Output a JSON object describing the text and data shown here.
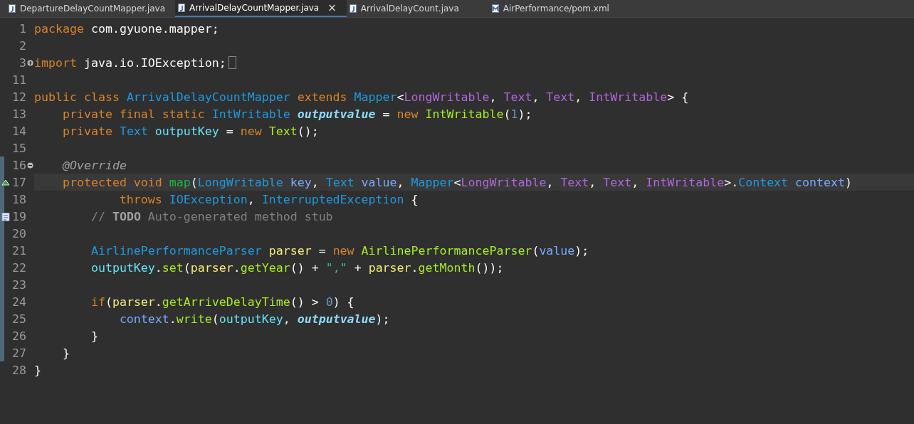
{
  "tabs": [
    {
      "label": "DepartureDelayCountMapper.java",
      "kind": "java",
      "selected": false
    },
    {
      "label": "ArrivalDelayCountMapper.java",
      "kind": "java",
      "selected": true,
      "close": "×"
    },
    {
      "label": "ArrivalDelayCount.java",
      "kind": "java",
      "selected": false
    },
    {
      "label": "AirPerformance/pom.xml",
      "kind": "xml",
      "selected": false
    }
  ],
  "editor": {
    "lines": [
      {
        "number": "1",
        "kind": "code",
        "changed": false,
        "current": false,
        "tokens": [
          {
            "kind": "keyword",
            "text": "package"
          },
          {
            "kind": "plain",
            "text": " com.gyuone.mapper;"
          }
        ]
      },
      {
        "number": "2",
        "kind": "code",
        "changed": false,
        "current": false
      },
      {
        "number": "3",
        "kind": "folded",
        "changed": false,
        "current": false,
        "tokens": [
          {
            "kind": "keyword",
            "text": "import"
          },
          {
            "kind": "plain",
            "text": " java.io.IOException;"
          }
        ]
      },
      {
        "number": "11",
        "kind": "code",
        "changed": false,
        "current": false
      },
      {
        "number": "12",
        "kind": "code",
        "changed": false,
        "current": false,
        "tokens": [
          {
            "kind": "keyword",
            "text": "public class "
          },
          {
            "kind": "type",
            "text": "ArrivalDelayCountMapper"
          },
          {
            "kind": "keyword",
            "text": " extends "
          },
          {
            "kind": "type",
            "text": "Mapper"
          },
          {
            "kind": "plain",
            "text": "<"
          },
          {
            "kind": "typearg",
            "text": "LongWritable"
          },
          {
            "kind": "plain",
            "text": ", "
          },
          {
            "kind": "typearg",
            "text": "Text"
          },
          {
            "kind": "plain",
            "text": ", "
          },
          {
            "kind": "typearg",
            "text": "Text"
          },
          {
            "kind": "plain",
            "text": ", "
          },
          {
            "kind": "typearg",
            "text": "IntWritable"
          },
          {
            "kind": "plain",
            "text": "> {"
          }
        ]
      },
      {
        "number": "13",
        "kind": "code",
        "changed": false,
        "current": false,
        "tokens": [
          {
            "kind": "keyword",
            "text": "    private final static "
          },
          {
            "kind": "type",
            "text": "IntWritable "
          },
          {
            "kind": "static",
            "text": "outputvalue"
          },
          {
            "kind": "plain",
            "text": " = "
          },
          {
            "kind": "keyword",
            "text": "new "
          },
          {
            "kind": "method",
            "text": "IntWritable"
          },
          {
            "kind": "plain",
            "text": "("
          },
          {
            "kind": "number",
            "text": "1"
          },
          {
            "kind": "plain",
            "text": ");"
          }
        ]
      },
      {
        "number": "14",
        "kind": "code",
        "changed": false,
        "current": false,
        "tokens": [
          {
            "kind": "keyword",
            "text": "    private "
          },
          {
            "kind": "type",
            "text": "Text "
          },
          {
            "kind": "field",
            "text": "outputKey"
          },
          {
            "kind": "plain",
            "text": " = "
          },
          {
            "kind": "keyword",
            "text": "new "
          },
          {
            "kind": "method",
            "text": "Text"
          },
          {
            "kind": "plain",
            "text": "();"
          }
        ]
      },
      {
        "number": "15",
        "kind": "code",
        "changed": false,
        "current": false
      },
      {
        "number": "16",
        "kind": "fold-start",
        "changed": true,
        "current": false,
        "tokens": [
          {
            "kind": "annotation",
            "text": "    @Override"
          }
        ]
      },
      {
        "number": "17",
        "kind": "override",
        "changed": true,
        "current": true,
        "tokens": [
          {
            "kind": "keyword",
            "text": "    protected void "
          },
          {
            "kind": "decl",
            "text": "map"
          },
          {
            "kind": "plain",
            "text": "("
          },
          {
            "kind": "type",
            "text": "LongWritable "
          },
          {
            "kind": "param",
            "text": "key"
          },
          {
            "kind": "plain",
            "text": ", "
          },
          {
            "kind": "type",
            "text": "Text "
          },
          {
            "kind": "param",
            "text": "value"
          },
          {
            "kind": "plain",
            "text": ", "
          },
          {
            "kind": "type",
            "text": "Mapper"
          },
          {
            "kind": "plain",
            "text": "<"
          },
          {
            "kind": "typearg",
            "text": "LongWritable"
          },
          {
            "kind": "plain",
            "text": ", "
          },
          {
            "kind": "typearg",
            "text": "Text"
          },
          {
            "kind": "plain",
            "text": ", "
          },
          {
            "kind": "typearg",
            "text": "Text"
          },
          {
            "kind": "plain",
            "text": ", "
          },
          {
            "kind": "typearg",
            "text": "IntWritable"
          },
          {
            "kind": "plain",
            "text": ">."
          },
          {
            "kind": "type",
            "text": "Context "
          },
          {
            "kind": "param",
            "text": "context"
          },
          {
            "kind": "plain",
            "text": ")"
          }
        ]
      },
      {
        "number": "18",
        "kind": "code",
        "changed": true,
        "current": false,
        "tokens": [
          {
            "kind": "keyword",
            "text": "            throws "
          },
          {
            "kind": "type",
            "text": "IOException"
          },
          {
            "kind": "plain",
            "text": ", "
          },
          {
            "kind": "type",
            "text": "InterruptedException"
          },
          {
            "kind": "plain",
            "text": " {"
          }
        ]
      },
      {
        "number": "19",
        "kind": "task",
        "changed": true,
        "current": false,
        "tokens": [
          {
            "kind": "comment",
            "text": "        // "
          },
          {
            "kind": "todo",
            "text": "TODO"
          },
          {
            "kind": "comment",
            "text": " Auto-generated method stub"
          }
        ]
      },
      {
        "number": "20",
        "kind": "code",
        "changed": true,
        "current": false
      },
      {
        "number": "21",
        "kind": "code",
        "changed": true,
        "current": false,
        "tokens": [
          {
            "kind": "type",
            "text": "        AirlinePerformanceParser "
          },
          {
            "kind": "local",
            "text": "parser"
          },
          {
            "kind": "plain",
            "text": " = "
          },
          {
            "kind": "keyword",
            "text": "new "
          },
          {
            "kind": "method",
            "text": "AirlinePerformanceParser"
          },
          {
            "kind": "plain",
            "text": "("
          },
          {
            "kind": "param",
            "text": "value"
          },
          {
            "kind": "plain",
            "text": ");"
          }
        ]
      },
      {
        "number": "22",
        "kind": "code",
        "changed": true,
        "current": false,
        "tokens": [
          {
            "kind": "field",
            "text": "        outputKey"
          },
          {
            "kind": "plain",
            "text": "."
          },
          {
            "kind": "method",
            "text": "set"
          },
          {
            "kind": "plain",
            "text": "("
          },
          {
            "kind": "local",
            "text": "parser"
          },
          {
            "kind": "plain",
            "text": "."
          },
          {
            "kind": "method",
            "text": "getYear"
          },
          {
            "kind": "plain",
            "text": "() + "
          },
          {
            "kind": "string",
            "text": "\",\""
          },
          {
            "kind": "plain",
            "text": " + "
          },
          {
            "kind": "local",
            "text": "parser"
          },
          {
            "kind": "plain",
            "text": "."
          },
          {
            "kind": "method",
            "text": "getMonth"
          },
          {
            "kind": "plain",
            "text": "());"
          }
        ]
      },
      {
        "number": "23",
        "kind": "code",
        "changed": true,
        "current": false
      },
      {
        "number": "24",
        "kind": "code",
        "changed": true,
        "current": false,
        "tokens": [
          {
            "kind": "keyword",
            "text": "        if"
          },
          {
            "kind": "plain",
            "text": "("
          },
          {
            "kind": "local",
            "text": "parser"
          },
          {
            "kind": "plain",
            "text": "."
          },
          {
            "kind": "method",
            "text": "getArriveDelayTime"
          },
          {
            "kind": "plain",
            "text": "() > "
          },
          {
            "kind": "number",
            "text": "0"
          },
          {
            "kind": "plain",
            "text": ") {"
          }
        ]
      },
      {
        "number": "25",
        "kind": "code",
        "changed": true,
        "current": false,
        "tokens": [
          {
            "kind": "param",
            "text": "            context"
          },
          {
            "kind": "plain",
            "text": "."
          },
          {
            "kind": "method",
            "text": "write"
          },
          {
            "kind": "plain",
            "text": "("
          },
          {
            "kind": "field",
            "text": "outputKey"
          },
          {
            "kind": "plain",
            "text": ", "
          },
          {
            "kind": "static",
            "text": "outputvalue"
          },
          {
            "kind": "plain",
            "text": ");"
          }
        ]
      },
      {
        "number": "26",
        "kind": "code",
        "changed": true,
        "current": false,
        "tokens": [
          {
            "kind": "plain",
            "text": "        }"
          }
        ]
      },
      {
        "number": "27",
        "kind": "code",
        "changed": true,
        "current": false,
        "tokens": [
          {
            "kind": "plain",
            "text": "    }"
          }
        ]
      },
      {
        "number": "28",
        "kind": "code",
        "changed": false,
        "current": false,
        "tokens": [
          {
            "kind": "plain",
            "text": "}"
          }
        ]
      }
    ]
  }
}
